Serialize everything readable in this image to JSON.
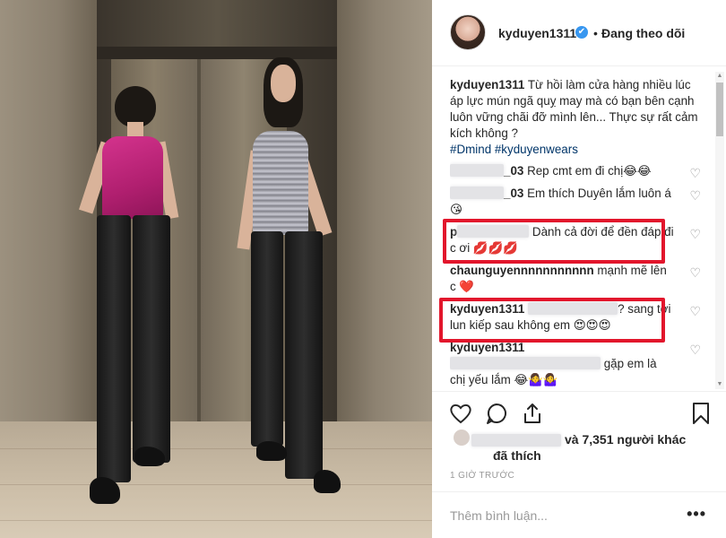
{
  "header": {
    "username": "kyduyen1311",
    "verified_icon": "✔",
    "separator": "•",
    "follow_status": "Đang theo dõi"
  },
  "caption": {
    "username": "kyduyen1311",
    "text": " Từ hồi làm cửa hàng nhiều lúc áp lực mún ngã quỵ may mà có bạn bên cạnh luôn vững chãi đỡ mình lên... Thực sự rất cảm kích không ?",
    "hashtags": "#Dmind #kyduyenwears"
  },
  "comments": [
    {
      "username_suffix": "_03",
      "text": " Rep cmt em đi chị😂😂"
    },
    {
      "username_suffix": "_03",
      "text": " Em thích Duyên lắm luôn á😘"
    },
    {
      "username_prefix": "p",
      "text": " Dành cả đời để đền đáp đi c ơi 💋💋💋"
    },
    {
      "username": "chaunguyennnnnnnnnnn",
      "text": " mạnh mẽ lên c ❤️"
    },
    {
      "username": "kyduyen1311",
      "text_suffix": "? sang tới lun kiếp sau không em 😍😍😍"
    },
    {
      "username": "kyduyen1311",
      "text": " gặp em là chị yếu lắm 😂🤷‍♀️🤷‍♀️"
    }
  ],
  "likes": {
    "count_text": "và 7,351 người khác",
    "tail": "đã thích"
  },
  "timestamp": "1 GIỜ TRƯỚC",
  "add_comment": {
    "placeholder": "Thêm bình luận..."
  },
  "more_label": "•••",
  "icons": {
    "heart": "♡",
    "scroll_up": "▲",
    "scroll_down": "▼"
  },
  "colors": {
    "accent_blue": "#3897f0",
    "hashtag": "#003569",
    "highlight_red": "#e2162c"
  }
}
